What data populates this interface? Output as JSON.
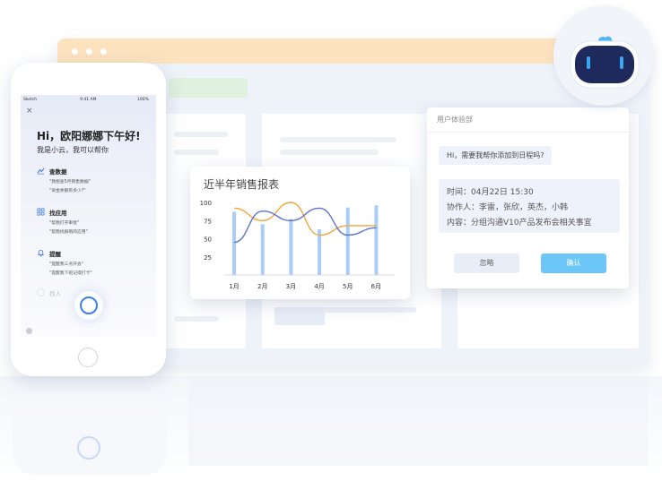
{
  "phone": {
    "status_carrier": "Sketch",
    "status_time": "9:41 AM",
    "status_battery": "100%",
    "close_glyph": "×",
    "greeting": "Hi，欧阳娜娜下午好!",
    "subtitle": "我是小云，我可以帮你",
    "sections": [
      {
        "title": "查数据",
        "icon": "chart-icon",
        "items": [
          "\"我想查5月销售数据\"",
          "\"资金余额有多少?\""
        ]
      },
      {
        "title": "找应用",
        "icon": "apps-icon",
        "items": [
          "\"帮我打开审批\"",
          "\"帮我找报销的应用\""
        ]
      },
      {
        "title": "提醒",
        "icon": "bell-icon",
        "items": [
          "\"提醒我三点开会\"",
          "\"提醒我下班记得打卡\""
        ]
      }
    ],
    "faded_item": "找人"
  },
  "chart": {
    "title": "近半年销售报表"
  },
  "chart_data": {
    "type": "bar",
    "title": "近半年销售报表",
    "categories": [
      "1月",
      "2月",
      "3月",
      "4月",
      "5月",
      "6月"
    ],
    "yticks": [
      100,
      75,
      50,
      25
    ],
    "ylim": [
      0,
      100
    ],
    "series": [
      {
        "type": "bar",
        "values": [
          87,
          70,
          77,
          63,
          93,
          96
        ],
        "color": "#a9cdf6"
      },
      {
        "type": "line",
        "values": [
          92,
          75,
          100,
          55,
          68,
          68
        ],
        "color": "#f4a43a"
      },
      {
        "type": "line",
        "values": [
          45,
          88,
          75,
          92,
          55,
          65
        ],
        "color": "#5c72d6"
      }
    ],
    "grid": false
  },
  "dialog": {
    "header": "用户体验部",
    "bubble": "Hi，需要我帮你添加到日程吗?",
    "time_line": "时间：04月22日 15:30",
    "collab_line": "协作人：李雷，张欣，英杰，小韩",
    "content_line": "内容：分组沟通V10产品发布会相关事宜",
    "ignore_label": "忽略",
    "confirm_label": "确认"
  },
  "colors": {
    "accent": "#6cc6f8",
    "browser_bar": "#fde2bf",
    "robot_face": "#1f2a5c",
    "robot_eye": "#39a9f4"
  }
}
